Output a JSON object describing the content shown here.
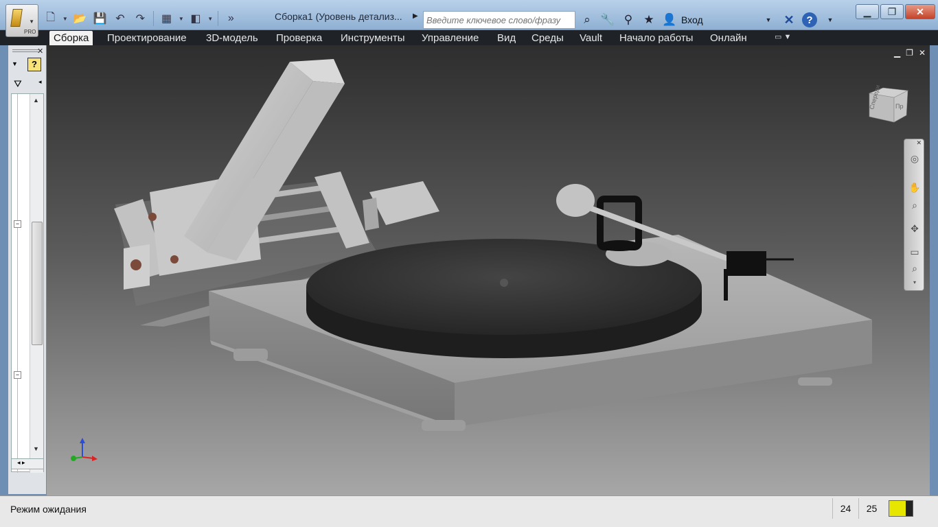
{
  "app": {
    "logo_label": "PRO",
    "document_title": "Сборка1 (Уровень детализ..."
  },
  "qat": {
    "icons": [
      "new-icon",
      "open-icon",
      "save-icon",
      "undo-icon",
      "redo-icon",
      "material-icon",
      "appearance-icon",
      "more-icon"
    ]
  },
  "search": {
    "placeholder": "Введите ключевое слово/фразу"
  },
  "header": {
    "login_label": "Вход",
    "help_label": "?"
  },
  "ribbon": {
    "tabs": [
      {
        "label": "Сборка",
        "active": true
      },
      {
        "label": "Проектирование"
      },
      {
        "label": "3D-модель"
      },
      {
        "label": "Проверка"
      },
      {
        "label": "Инструменты"
      },
      {
        "label": "Управление"
      },
      {
        "label": "Вид"
      },
      {
        "label": "Среды"
      },
      {
        "label": "Vault"
      },
      {
        "label": "Начало работы"
      },
      {
        "label": "Онлайн"
      }
    ]
  },
  "browser": {
    "help_label": "?"
  },
  "viewcube": {
    "front_label": "Спереди",
    "right_label": "Пр"
  },
  "status": {
    "text": "Режим ожидания",
    "count_a": "24",
    "count_b": "25"
  },
  "colors": {
    "ribbon_bg": "#1f2328",
    "status_mem": "#e6e600"
  }
}
